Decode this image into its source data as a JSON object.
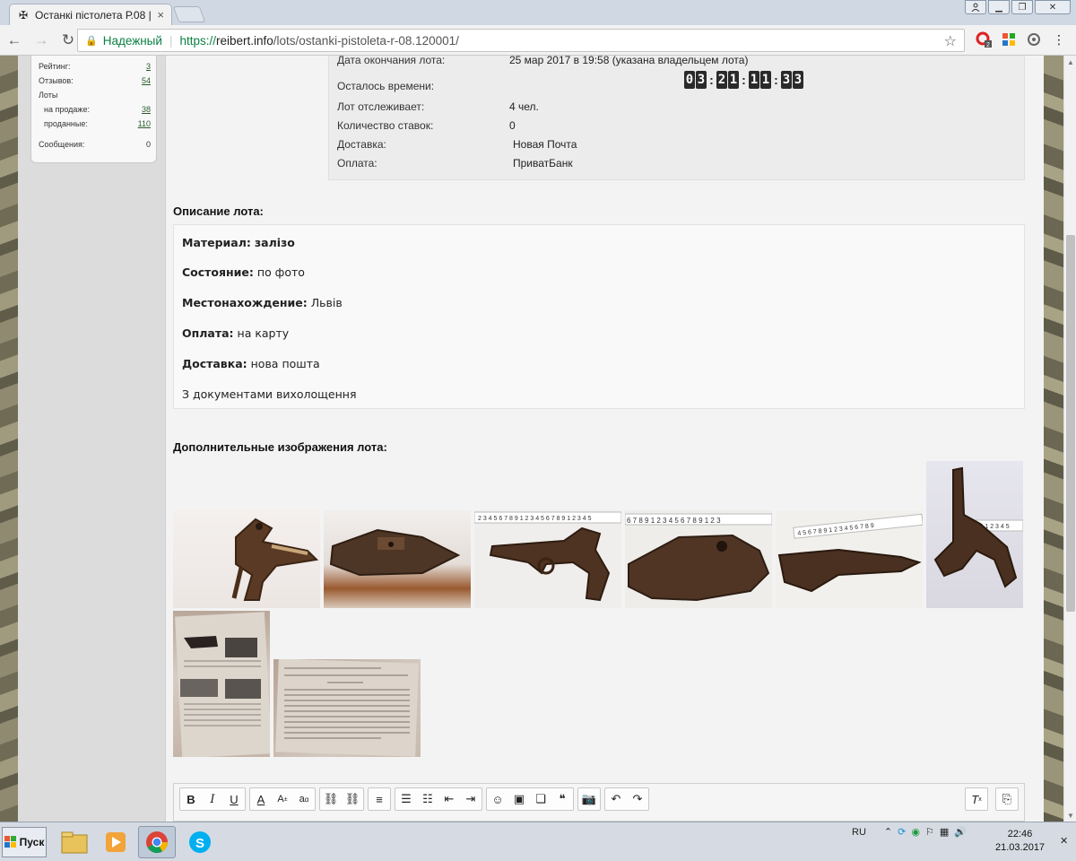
{
  "browser": {
    "tab_title": "Останкі пістолета Р.08 |",
    "secure_label": "Надежный",
    "url_prefix": "https://",
    "url_domain": "reibert.info",
    "url_path": "/lots/ostanki-pistoleta-r-08.120001/"
  },
  "seller": {
    "rating_label": "Рейтинг:",
    "rating_value": "3",
    "reviews_label": "Отзывов:",
    "reviews_value": "54",
    "lots_label": "Лоты",
    "selling_label": "на продаже:",
    "selling_value": "38",
    "sold_label": "проданные:",
    "sold_value": "110",
    "messages_label": "Сообщения:",
    "messages_value": "0"
  },
  "lot": {
    "end_label": "Дата окончания лота:",
    "end_value": "25 мар 2017 в 19:58 (указана владельцем лота)",
    "remaining_label": "Осталось времени:",
    "timer": {
      "d": "03",
      "h": "21",
      "m": "11",
      "s": "33"
    },
    "watching_label": "Лот отслеживает:",
    "watching_value": "4 чел.",
    "bids_label": "Количество ставок:",
    "bids_value": "0",
    "delivery_label": "Доставка:",
    "delivery_value": "Новая Почта",
    "payment_label": "Оплата:",
    "payment_value": "ПриватБанк"
  },
  "description": {
    "title": "Описание лота:",
    "material_label": "Материал:",
    "material_value": "залізо",
    "condition_label": "Состояние:",
    "condition_value": "по фото",
    "location_label": "Местонахождение:",
    "location_value": "Львів",
    "payment_label": "Оплата:",
    "payment_value": "на карту",
    "delivery_label": "Доставка:",
    "delivery_value": "нова пошта",
    "note": "З документами вихолощення"
  },
  "images": {
    "title": "Дополнительные изображения лота:"
  },
  "taskbar": {
    "start_label": "Пуск",
    "lang": "RU",
    "time": "22:46",
    "date": "21.03.2017"
  }
}
